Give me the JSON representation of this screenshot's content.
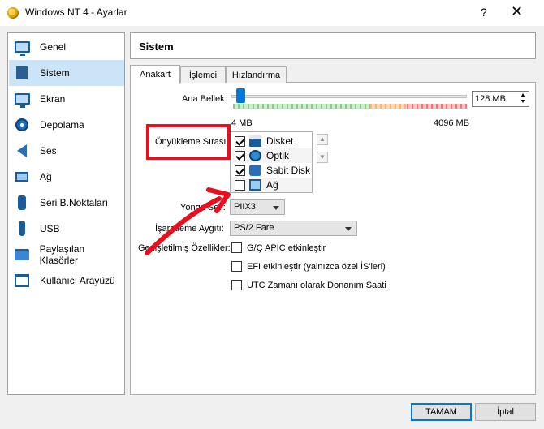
{
  "window": {
    "title": "Windows NT 4 - Ayarlar",
    "help_glyph": "?",
    "close_glyph": "✕"
  },
  "sidebar": {
    "items": [
      {
        "label": "Genel",
        "icon": "monitor-icon"
      },
      {
        "label": "Sistem",
        "icon": "chip-icon"
      },
      {
        "label": "Ekran",
        "icon": "display-icon"
      },
      {
        "label": "Depolama",
        "icon": "storage-icon"
      },
      {
        "label": "Ses",
        "icon": "speaker-icon"
      },
      {
        "label": "Ağ",
        "icon": "network-icon"
      },
      {
        "label": "Seri B.Noktaları",
        "icon": "serial-port-icon"
      },
      {
        "label": "USB",
        "icon": "usb-icon"
      },
      {
        "label": "Paylaşılan Klasörler",
        "icon": "shared-folder-icon"
      },
      {
        "label": "Kullanıcı Arayüzü",
        "icon": "user-interface-icon"
      }
    ],
    "selected": "Sistem"
  },
  "main": {
    "title": "Sistem",
    "tabs": [
      {
        "label": "Anakart",
        "active": true
      },
      {
        "label": "İşlemci",
        "active": false
      },
      {
        "label": "Hızlandırma",
        "active": false
      }
    ],
    "memory": {
      "label": "Ana Bellek:",
      "value": "128 MB",
      "min_label": "4 MB",
      "max_label": "4096 MB",
      "fraction": 0.03
    },
    "boot_order": {
      "label": "Önyükleme Sırası:",
      "items": [
        {
          "label": "Disket",
          "checked": true,
          "icon": "floppy-icon"
        },
        {
          "label": "Optik",
          "checked": true,
          "icon": "optical-disc-icon"
        },
        {
          "label": "Sabit Disk",
          "checked": true,
          "icon": "hard-disk-icon"
        },
        {
          "label": "Ağ",
          "checked": false,
          "icon": "network-boot-icon"
        }
      ],
      "up_glyph": "▲",
      "down_glyph": "▼"
    },
    "chipset": {
      "label": "Yonga Seti:",
      "value": "PIIX3"
    },
    "pointing": {
      "label": "İşaretleme Aygıtı:",
      "value": "PS/2 Fare"
    },
    "extended": {
      "label": "Genişletilmiş Özellikler:",
      "options": [
        {
          "label": "G/Ç APIC etkinleştir",
          "checked": false
        },
        {
          "label": "EFI etkinleştir (yalnızca özel İS'leri)",
          "checked": false
        },
        {
          "label": "UTC Zamanı olarak Donanım Saati",
          "checked": false
        }
      ]
    }
  },
  "buttons": {
    "ok": "TAMAM",
    "cancel": "İptal"
  },
  "colors": {
    "annotation": "#e8101f",
    "accent": "#0078d7",
    "selection": "#cce4f7"
  }
}
